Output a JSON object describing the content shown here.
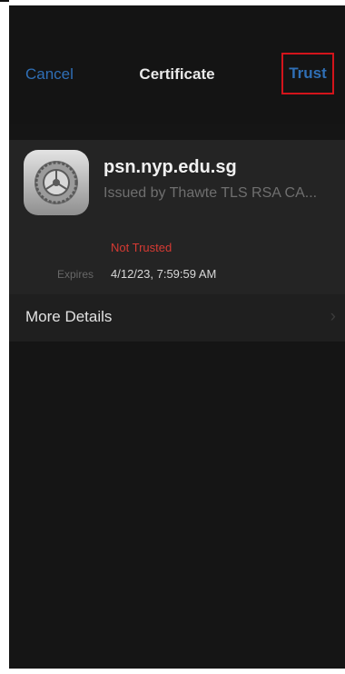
{
  "nav": {
    "cancel": "Cancel",
    "title": "Certificate",
    "trust": "Trust"
  },
  "certificate": {
    "name": "psn.nyp.edu.sg",
    "issuer": "Issued by Thawte TLS RSA CA...",
    "status": "Not Trusted",
    "expires_label": "Expires",
    "expires_value": "4/12/23, 7:59:59 AM"
  },
  "details": {
    "label": "More Details"
  },
  "icons": {
    "app": "settings-gear-icon",
    "chevron": "chevron-right-icon"
  },
  "colors": {
    "accent": "#2f6fb6",
    "warning": "#d63a33",
    "highlight": "#d3141b"
  }
}
